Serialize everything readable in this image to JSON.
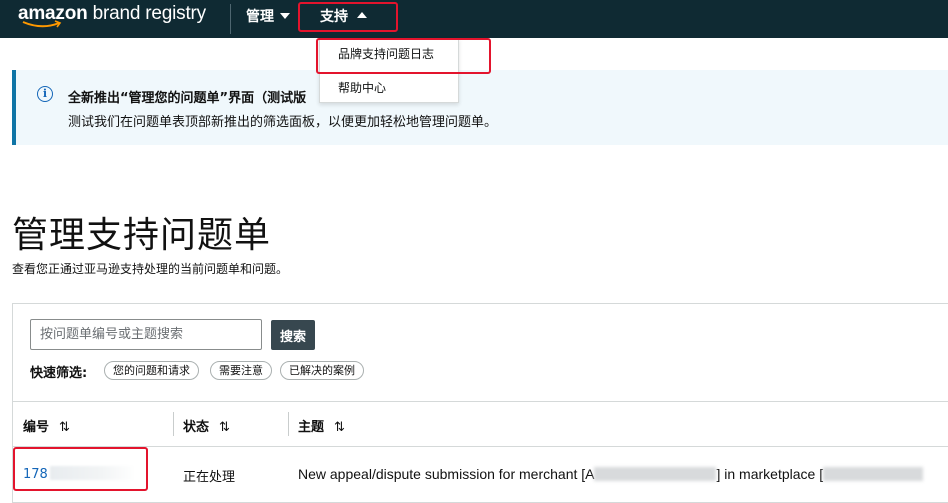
{
  "nav": {
    "logo_bold": "amazon",
    "logo_rest": " brand registry",
    "manage_label": "管理",
    "support_label": "支持"
  },
  "support_menu": {
    "items": [
      {
        "label": "品牌支持问题日志"
      },
      {
        "label": "帮助中心"
      }
    ]
  },
  "banner": {
    "title": "全新推出“管理您的问题单”界面（测试版",
    "text": "测试我们在问题单表顶部新推出的筛选面板，以便更加轻松地管理问题单。"
  },
  "page": {
    "title": "管理支持问题单",
    "subtitle": "查看您正通过亚马逊支持处理的当前问题单和问题。"
  },
  "search": {
    "placeholder": "按问题单编号或主题搜索",
    "button_label": "搜索"
  },
  "quick_filters": {
    "label": "快速筛选:",
    "chips": [
      "您的问题和请求",
      "需要注意",
      "已解决的案例"
    ]
  },
  "table": {
    "columns": [
      "编号",
      "状态",
      "主题"
    ],
    "sort_icon": "⇅",
    "rows": [
      {
        "id_visible": "178",
        "status": "正在处理",
        "subject_part1": "New appeal/dispute submission for merchant [A",
        "subject_part2": "] in marketplace ["
      }
    ]
  },
  "colors": {
    "nav_bg": "#0f2a33",
    "banner_bg": "#f0f8fc",
    "banner_accent": "#0f75a6",
    "link": "#1466b8",
    "highlight": "#e3142d",
    "search_button": "#37474f"
  }
}
